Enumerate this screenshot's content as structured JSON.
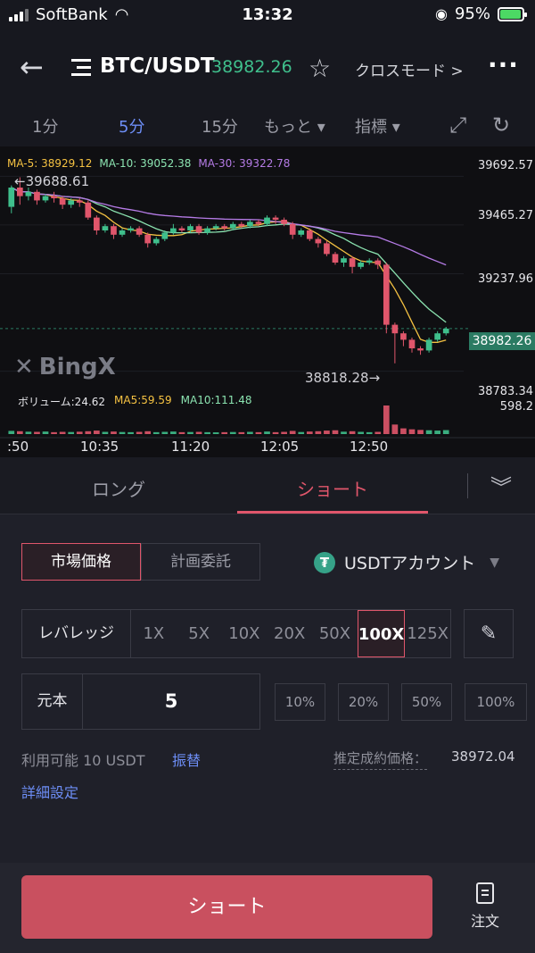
{
  "status_bar": {
    "carrier": "SoftBank",
    "time": "13:32",
    "battery": "95%"
  },
  "header": {
    "back_icon": "arrow-left-icon",
    "menu_icon": "menu-icon",
    "pair": "BTC/USDT",
    "price": "38982.26",
    "star_icon": "star-icon",
    "mode": "クロスモード >",
    "more_icon": "more-dots-icon"
  },
  "timebar": {
    "items": [
      "1分",
      "5分",
      "15分",
      "もっと ▾",
      "指標 ▾"
    ],
    "active_index": 1
  },
  "chart_data": {
    "type": "candlestick",
    "ma_legend": [
      {
        "label": "MA-5: 38929.12",
        "color": "#f5c242"
      },
      {
        "label": "MA-10: 39052.38",
        "color": "#8be3b0"
      },
      {
        "label": "MA-30: 39322.78",
        "color": "#b57be6"
      }
    ],
    "y_ticks": [
      "39692.57",
      "39465.27",
      "39237.96",
      "38783.34"
    ],
    "volume_tick": "598.2",
    "current_price": "38982.26",
    "x_ticks": [
      ":50",
      "10:35",
      "11:20",
      "12:05",
      "12:50"
    ],
    "high_annotation": "←39688.61",
    "low_annotation": "38818.28→",
    "watermark": "BingX",
    "volume_legend": {
      "label": "ボリューム:24.62",
      "ma5": "MA5:59.59",
      "ma10": "MA10:111.48"
    },
    "up_color": "#3fbf8c",
    "down_color": "#e0566b",
    "ylim": [
      38740,
      39740
    ],
    "candles": [
      [
        39550,
        39640,
        39520,
        39650
      ],
      [
        39640,
        39600,
        39560,
        39688
      ],
      [
        39600,
        39620,
        39580,
        39640
      ],
      [
        39620,
        39580,
        39560,
        39630
      ],
      [
        39580,
        39600,
        39570,
        39610
      ],
      [
        39600,
        39590,
        39570,
        39620
      ],
      [
        39590,
        39560,
        39540,
        39600
      ],
      [
        39560,
        39580,
        39545,
        39590
      ],
      [
        39580,
        39570,
        39550,
        39590
      ],
      [
        39570,
        39500,
        39490,
        39580
      ],
      [
        39500,
        39440,
        39420,
        39510
      ],
      [
        39440,
        39460,
        39430,
        39470
      ],
      [
        39460,
        39420,
        39400,
        39470
      ],
      [
        39420,
        39440,
        39410,
        39450
      ],
      [
        39440,
        39450,
        39430,
        39460
      ],
      [
        39450,
        39420,
        39410,
        39460
      ],
      [
        39420,
        39380,
        39360,
        39430
      ],
      [
        39380,
        39400,
        39370,
        39410
      ],
      [
        39400,
        39430,
        39390,
        39440
      ],
      [
        39430,
        39450,
        39420,
        39470
      ],
      [
        39450,
        39440,
        39430,
        39460
      ],
      [
        39440,
        39460,
        39430,
        39470
      ],
      [
        39460,
        39430,
        39420,
        39470
      ],
      [
        39430,
        39450,
        39420,
        39460
      ],
      [
        39450,
        39460,
        39440,
        39470
      ],
      [
        39460,
        39450,
        39440,
        39470
      ],
      [
        39450,
        39470,
        39440,
        39480
      ],
      [
        39470,
        39460,
        39450,
        39480
      ],
      [
        39460,
        39480,
        39450,
        39490
      ],
      [
        39480,
        39470,
        39460,
        39490
      ],
      [
        39470,
        39500,
        39460,
        39510
      ],
      [
        39500,
        39490,
        39470,
        39510
      ],
      [
        39490,
        39470,
        39460,
        39500
      ],
      [
        39470,
        39420,
        39400,
        39480
      ],
      [
        39420,
        39440,
        39410,
        39450
      ],
      [
        39440,
        39400,
        39390,
        39450
      ],
      [
        39400,
        39380,
        39360,
        39410
      ],
      [
        39380,
        39330,
        39320,
        39390
      ],
      [
        39330,
        39290,
        39280,
        39340
      ],
      [
        39290,
        39310,
        39270,
        39320
      ],
      [
        39310,
        39270,
        39240,
        39320
      ],
      [
        39270,
        39290,
        39260,
        39300
      ],
      [
        39290,
        39300,
        39280,
        39310
      ],
      [
        39300,
        39280,
        39260,
        39310
      ],
      [
        39280,
        39000,
        38960,
        39290
      ],
      [
        39000,
        38960,
        38820,
        39010
      ],
      [
        38960,
        38930,
        38900,
        38970
      ],
      [
        38930,
        38890,
        38870,
        38940
      ],
      [
        38890,
        38880,
        38860,
        38900
      ],
      [
        38880,
        38930,
        38870,
        38940
      ],
      [
        38930,
        38960,
        38920,
        38970
      ],
      [
        38960,
        38982,
        38950,
        38990
      ]
    ],
    "volumes": [
      20,
      18,
      15,
      14,
      16,
      12,
      14,
      13,
      15,
      18,
      22,
      14,
      16,
      13,
      12,
      14,
      18,
      12,
      14,
      16,
      12,
      13,
      14,
      12,
      11,
      12,
      13,
      12,
      14,
      12,
      16,
      12,
      14,
      20,
      13,
      16,
      18,
      22,
      24,
      15,
      18,
      14,
      12,
      14,
      180,
      60,
      36,
      30,
      26,
      24,
      22,
      25
    ]
  },
  "tabs": {
    "long": "ロング",
    "short": "ショート",
    "collapse_icon": "double-chevron-down-icon"
  },
  "form": {
    "order_types": [
      "市場価格",
      "計画委託"
    ],
    "selected_order_type": 0,
    "account": "USDTアカウント",
    "account_icon": "tether-icon",
    "leverage_label": "レバレッジ",
    "leverage_options": [
      "1X",
      "5X",
      "10X",
      "20X",
      "50X",
      "100X",
      "125X"
    ],
    "selected_leverage": 5,
    "edit_icon": "pencil-icon",
    "principal_label": "元本",
    "principal_value": "5",
    "percent_options": [
      "10%",
      "20%",
      "50%",
      "100%"
    ],
    "available": "利用可能 10 USDT",
    "transfer": "振替",
    "estimated_label": "推定成約価格：",
    "estimated_value": "38972.04",
    "details": "詳細設定"
  },
  "bottom": {
    "short_button": "ショート",
    "orders_label": "注文",
    "orders_icon": "clipboard-icon"
  }
}
